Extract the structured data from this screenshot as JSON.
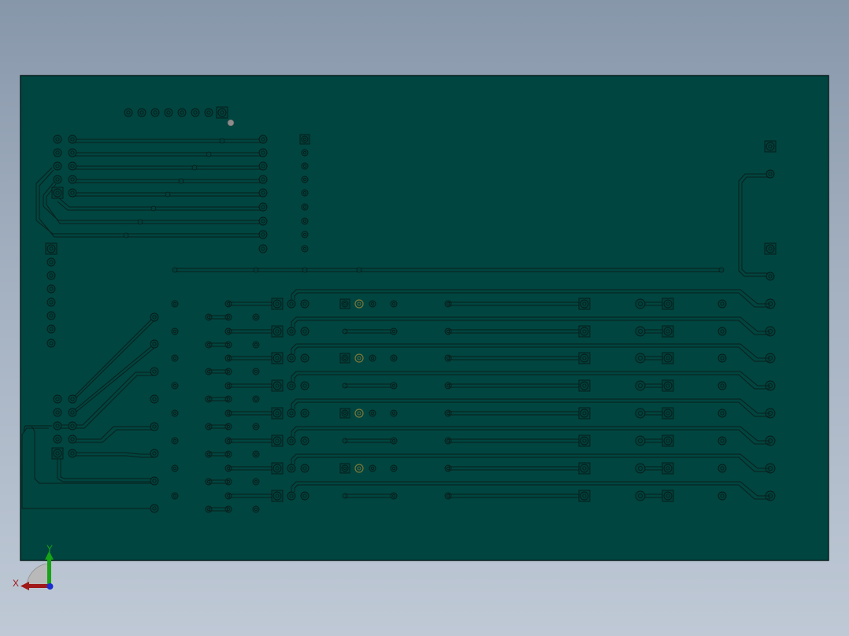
{
  "viewport": {
    "background_top": "#8797aa",
    "background_bottom": "#bfc9d6"
  },
  "pcb": {
    "board_color": "#004540",
    "outline_color": "#0a1f1d",
    "trace_color": "#0a1f1d",
    "pad_fill": "#00403b",
    "pad_stroke": "#071a18",
    "accent_pad_color": "#7a7a3a",
    "fiducial_color": "#8c8c8c"
  },
  "triad": {
    "x_label": "X",
    "y_label": "Y",
    "x_color": "#a01818",
    "y_color": "#16a416",
    "z_color": "#1a2fd0"
  }
}
